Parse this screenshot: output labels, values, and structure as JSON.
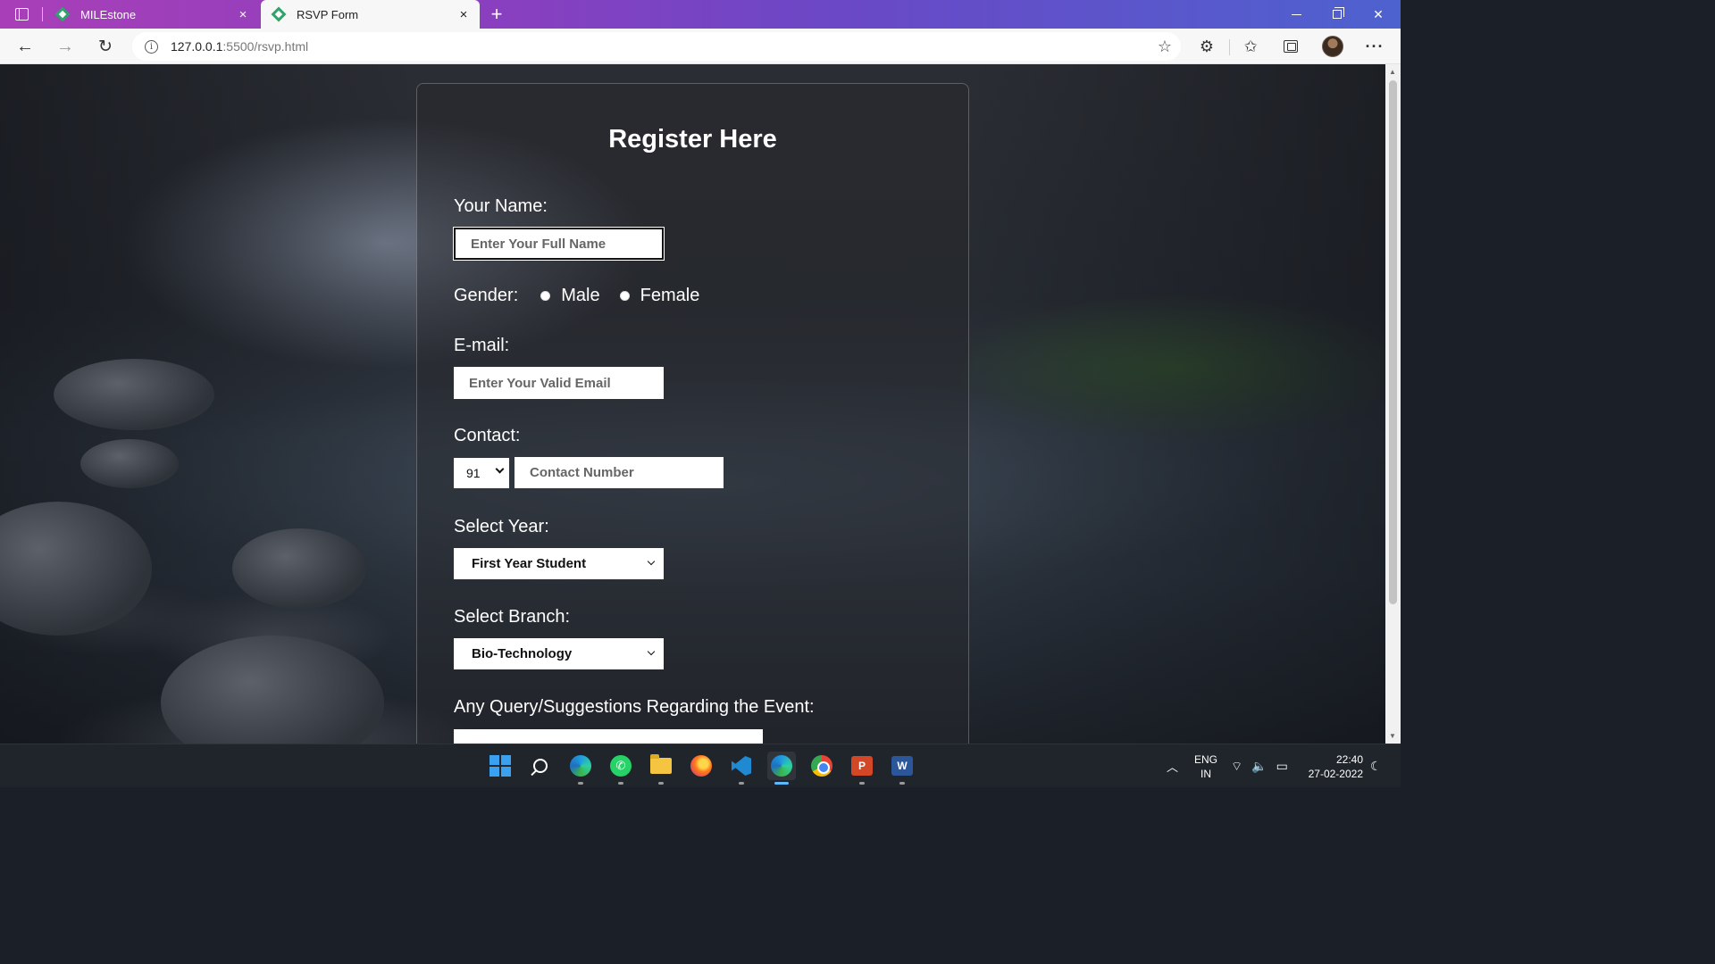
{
  "browser": {
    "tabs": [
      {
        "label": "MILEstone",
        "active": false,
        "close": "×"
      },
      {
        "label": "RSVP Form",
        "active": true,
        "close": "×"
      }
    ],
    "new_tab": "+",
    "url_host": "127.0.0.1",
    "url_rest": ":5500/rsvp.html",
    "icons": [
      "tab-actions-icon",
      "back-icon",
      "forward-icon",
      "reload-icon",
      "info-icon",
      "add-favorite-icon",
      "extensions-icon",
      "favorites-icon",
      "collections-icon",
      "profile-avatar",
      "more-icon"
    ]
  },
  "form": {
    "title": "Register Here",
    "name_label": "Your Name:",
    "name_placeholder": "Enter Your Full Name",
    "gender_label": "Gender:",
    "gender_options": [
      "Male",
      "Female"
    ],
    "email_label": "E-mail:",
    "email_placeholder": "Enter Your Valid Email",
    "contact_label": "Contact:",
    "country_code": "91",
    "contact_placeholder": "Contact Number",
    "year_label": "Select Year:",
    "year_value": "First Year Student",
    "branch_label": "Select Branch:",
    "branch_value": "Bio-Technology",
    "query_label": "Any Query/Suggestions Regarding the Event:"
  },
  "taskbar": {
    "apps": [
      "windows-start",
      "search",
      "edge",
      "whatsapp",
      "file-explorer",
      "firefox",
      "vscode",
      "edge-dev",
      "chrome",
      "powerpoint",
      "word"
    ],
    "lang_top": "ENG",
    "lang_bottom": "IN",
    "time": "22:40",
    "date": "27-02-2022"
  },
  "colors": {
    "titlebar_start": "#a93fb8",
    "titlebar_end": "#4e62cf",
    "taskbar": "#20242b"
  }
}
